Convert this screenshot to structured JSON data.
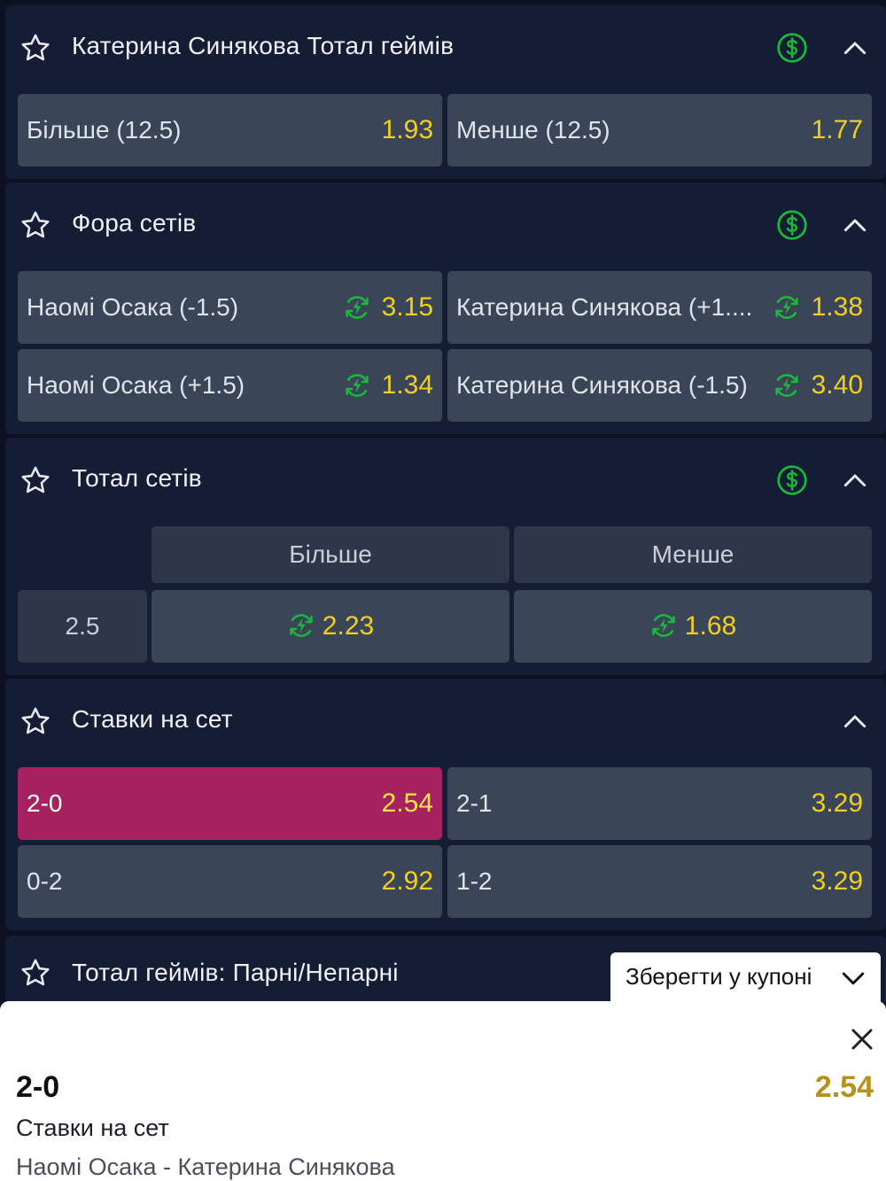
{
  "colors": {
    "background": "#0b1121",
    "panel": "#141d33",
    "button": "#3b4558",
    "selected": "#a6215f",
    "odds": "#f2cf1d",
    "green_icon": "#19b93c"
  },
  "markets": [
    {
      "title": "Катерина Синякова Тотал геймів",
      "icons": [
        "star-icon",
        "dollar-icon",
        "chevron-up-icon"
      ],
      "outcomes": [
        {
          "label": "Більше (12.5)",
          "odds": "1.93"
        },
        {
          "label": "Менше (12.5)",
          "odds": "1.77"
        }
      ]
    },
    {
      "title": "Фора сетів",
      "icons": [
        "star-icon",
        "dollar-icon",
        "chevron-up-icon"
      ],
      "outcomes": [
        {
          "label": "Наомі Осака (-1.5)",
          "odds": "3.15",
          "boost": true
        },
        {
          "label": "Катерина Синякова (+1....",
          "odds": "1.38",
          "boost": true
        },
        {
          "label": "Наомі Осака (+1.5)",
          "odds": "1.34",
          "boost": true
        },
        {
          "label": "Катерина Синякова (-1.5)",
          "odds": "3.40",
          "boost": true
        }
      ]
    },
    {
      "title": "Тотал сетів",
      "icons": [
        "star-icon",
        "dollar-icon",
        "chevron-up-icon"
      ],
      "headers": [
        "Більше",
        "Менше"
      ],
      "rows": [
        {
          "line": "2.5",
          "over": "2.23",
          "under": "1.68"
        }
      ]
    },
    {
      "title": "Ставки на сет",
      "icons": [
        "star-icon",
        "chevron-up-icon"
      ],
      "outcomes": [
        {
          "label": "2-0",
          "odds": "2.54",
          "selected": true
        },
        {
          "label": "2-1",
          "odds": "3.29"
        },
        {
          "label": "0-2",
          "odds": "2.92"
        },
        {
          "label": "1-2",
          "odds": "3.29"
        }
      ]
    },
    {
      "title": "Тотал геймів: Парні/Непарні",
      "icons": [
        "star-icon"
      ]
    }
  ],
  "save_button": {
    "label": "Зберегти у купоні",
    "icon": "chevron-down-icon"
  },
  "bet_slip": {
    "selection": "2-0",
    "odds": "2.54",
    "market": "Ставки на сет",
    "event": "Наомі Осака - Катерина Синякова",
    "close_icon": "close-icon"
  }
}
